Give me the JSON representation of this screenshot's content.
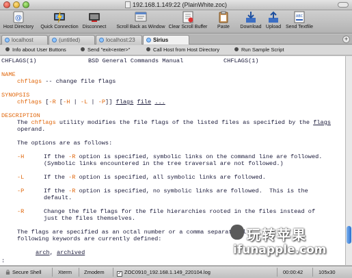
{
  "window": {
    "title": "192.168.1.149:22 (PlainWhite.zoc)"
  },
  "toolbar": {
    "items": [
      {
        "label": "Host Directory",
        "icon": "host-directory-icon"
      },
      {
        "label": "Quick Connection",
        "icon": "quick-connection-icon"
      },
      {
        "label": "Disconnect",
        "icon": "disconnect-icon"
      },
      {
        "label": "Scroll Back as Window",
        "icon": "scroll-back-icon"
      },
      {
        "label": "Clear Scroll Buffer",
        "icon": "clear-buffer-icon"
      },
      {
        "label": "Paste",
        "icon": "paste-icon"
      },
      {
        "label": "Download",
        "icon": "download-icon"
      },
      {
        "label": "Upload",
        "icon": "upload-icon"
      },
      {
        "label": "Send Textfile",
        "icon": "send-textfile-icon"
      }
    ]
  },
  "tabs": [
    {
      "label": "localhost",
      "active": false
    },
    {
      "label": "(untitled)",
      "active": false
    },
    {
      "label": "localhost:23",
      "active": false
    },
    {
      "label": "Sirius",
      "active": true
    }
  ],
  "user_buttons": [
    "Info about User Buttons",
    "Send \"exit<enter>\"",
    "Call Host from Host Directory",
    "Run Sample Script"
  ],
  "terminal": {
    "header_left": "CHFLAGS(1)",
    "header_center": "BSD General Commands Manual",
    "header_right": "CHFLAGS(1)",
    "name_heading": "NAME",
    "name_cmd": "chflags",
    "name_desc": " -- change file flags",
    "synopsis_heading": "SYNOPSIS",
    "syn_cmd": "chflags",
    "syn_open1": " [",
    "syn_R": "-R",
    "syn_open2": " [",
    "syn_H": "-H",
    "syn_bar1": " | ",
    "syn_L": "-L",
    "syn_bar2": " | ",
    "syn_P": "-P",
    "syn_close": "]] ",
    "syn_flags": "flags",
    "syn_sp1": " ",
    "syn_file": "file",
    "syn_sp2": " ",
    "syn_dots": "...",
    "description_heading": "DESCRIPTION",
    "desc1_pre": "The ",
    "desc1_cmd": "chflags",
    "desc1_mid": " utility modifies the file flags of the listed files as specified by the ",
    "desc1_flags": "flags",
    "desc2": "operand.",
    "options_intro": "The options are as follows:",
    "opt_H": "-H",
    "opt_H_pre": "If the ",
    "opt_H_R": "-R",
    "opt_H_post": " option is specified, symbolic links on the command line are followed.",
    "opt_H_line2": "(Symbolic links encountered in the tree traversal are not followed.)",
    "opt_L": "-L",
    "opt_L_pre": "If the ",
    "opt_L_R": "-R",
    "opt_L_post": " option is specified, all symbolic links are followed.",
    "opt_P": "-P",
    "opt_P_pre": "If the ",
    "opt_P_R": "-R",
    "opt_P_post": " option is specified, no symbolic links are followed.  This is the",
    "opt_P_line2": "default.",
    "opt_R": "-R",
    "opt_R_line1": "Change the file flags for the file hierarchies rooted in the files instead of",
    "opt_R_line2": "just the files themselves.",
    "flags1": "The flags are specified as an octal number or a comma separated l",
    "flags2": "following keywords are currently defined:",
    "kw_arch": "arch",
    "kw_sep": ", ",
    "kw_archived": "archived",
    "prompt": ":"
  },
  "watermark": {
    "cjk": "玩转苹果",
    "url": "ifunapple.com"
  },
  "status": {
    "protocol": "Secure Shell",
    "emulation": "Xterm",
    "transfer": "Zmodem",
    "log_checked": true,
    "log_file": "ZOC0910_192.168.1.149_220104.log",
    "timer": "00:00:42",
    "size": "105x30"
  },
  "colors": {
    "accent_orange": "#e0660a",
    "terminal_text": "#1a1a3a",
    "terminal_bg": "#ffffff"
  }
}
